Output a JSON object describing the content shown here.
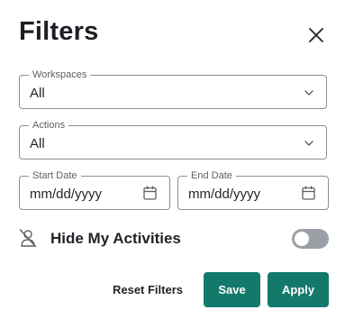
{
  "header": {
    "title": "Filters",
    "close_icon": "close-icon"
  },
  "workspaces": {
    "legend": "Workspaces",
    "value": "All"
  },
  "actions": {
    "legend": "Actions",
    "value": "All"
  },
  "start_date": {
    "legend": "Start Date",
    "placeholder": "mm/dd/yyyy"
  },
  "end_date": {
    "legend": "End Date",
    "placeholder": "mm/dd/yyyy"
  },
  "hide_my_activities": {
    "label": "Hide My Activities",
    "enabled": false,
    "icon": "person-off-icon"
  },
  "buttons": {
    "reset": "Reset Filters",
    "save": "Save",
    "apply": "Apply"
  },
  "colors": {
    "primary": "#137a6b",
    "toggle_off": "#9aa0a6",
    "border": "#8a8f96"
  }
}
